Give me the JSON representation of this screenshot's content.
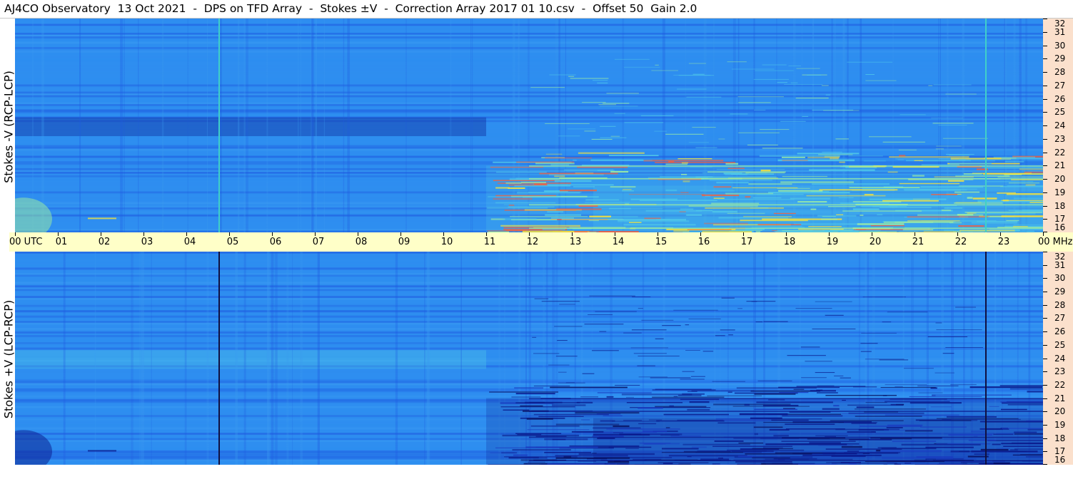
{
  "title": "AJ4CO Observatory  13 Oct 2021  -  DPS on TFD Array  -  Stokes ±V  -  Correction Array 2017 01 10.csv  -  Offset 50  Gain 2.0",
  "chart_data": [
    {
      "type": "heatmap",
      "panel": "top",
      "ylabel": "Stokes -V (RCP-LCP)",
      "xlabel": "UTC",
      "x_ticks": [
        "00",
        "01",
        "02",
        "03",
        "04",
        "05",
        "06",
        "07",
        "08",
        "09",
        "10",
        "11",
        "12",
        "13",
        "14",
        "15",
        "16",
        "17",
        "18",
        "19",
        "20",
        "21",
        "22",
        "23",
        "00"
      ],
      "x_range_hours": [
        0,
        24
      ],
      "y_unit": "MHz",
      "y_ticks": [
        16,
        17,
        18,
        19,
        20,
        21,
        22,
        23,
        24,
        25,
        26,
        27,
        28,
        29,
        30,
        31,
        32
      ],
      "ylim": [
        16,
        32
      ],
      "vertical_lines_utc": [
        4.75,
        22.65
      ],
      "vertical_line_color": "#40d0c8",
      "colormap": [
        "#0a1a8c",
        "#1e5ae0",
        "#2e8ef0",
        "#50c8e8",
        "#a0f0a0",
        "#f0e040",
        "#f06040"
      ]
    },
    {
      "type": "heatmap",
      "panel": "bottom",
      "ylabel": "Stokes +V (LCP-RCP)",
      "xlabel": "UTC",
      "x_ticks": [
        "00",
        "01",
        "02",
        "03",
        "04",
        "05",
        "06",
        "07",
        "08",
        "09",
        "10",
        "11",
        "12",
        "13",
        "14",
        "15",
        "16",
        "17",
        "18",
        "19",
        "20",
        "21",
        "22",
        "23",
        "00"
      ],
      "x_range_hours": [
        0,
        24
      ],
      "y_unit": "MHz",
      "y_ticks": [
        16,
        17,
        18,
        19,
        20,
        21,
        22,
        23,
        24,
        25,
        26,
        27,
        28,
        29,
        30,
        31,
        32
      ],
      "ylim": [
        16,
        32
      ],
      "vertical_lines_utc": [
        4.75,
        22.65
      ],
      "vertical_line_color": "#101040",
      "colormap": [
        "#0a1a8c",
        "#1e5ae0",
        "#2e8ef0",
        "#50c8e8",
        "#a0f0a0",
        "#f0e040",
        "#f06040"
      ]
    }
  ],
  "timebar": {
    "first_label": "00  UTC",
    "last_label": "00 MHz"
  }
}
